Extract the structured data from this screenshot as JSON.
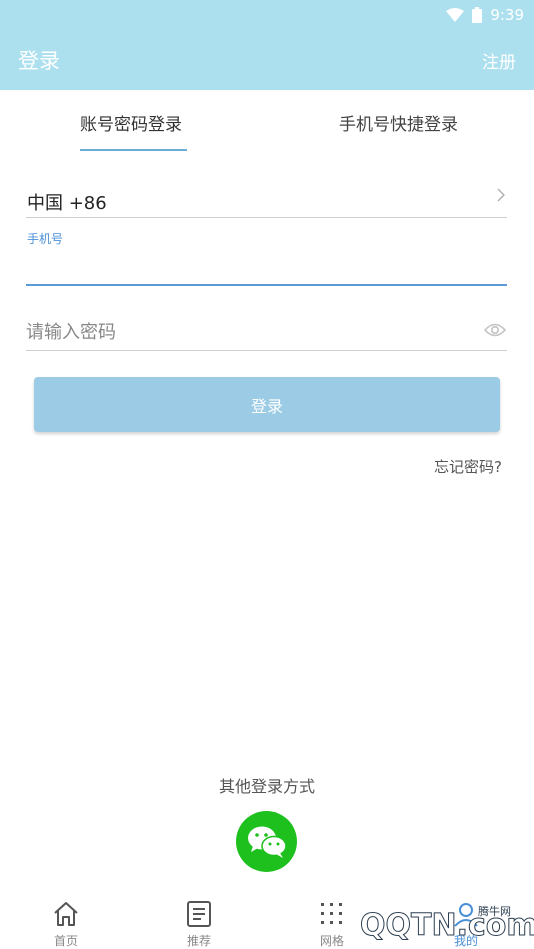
{
  "status_bar": {
    "time": "9:39"
  },
  "header": {
    "title": "登录",
    "register": "注册"
  },
  "tabs": [
    {
      "label": "账号密码登录",
      "active": true
    },
    {
      "label": "手机号快捷登录",
      "active": false
    }
  ],
  "form": {
    "country": "中国 +86",
    "phone_label": "手机号",
    "phone_value": "",
    "password_placeholder": "请输入密码",
    "login_button": "登录",
    "forgot": "忘记密码?"
  },
  "other_login": {
    "label": "其他登录方式",
    "wechat_icon": "wechat-icon"
  },
  "bottom_nav": [
    {
      "label": "首页",
      "icon": "home-icon"
    },
    {
      "label": "推荐",
      "icon": "document-icon"
    },
    {
      "label": "网格",
      "icon": "grid-icon"
    },
    {
      "label": "我的",
      "icon": "user-icon",
      "active": true
    }
  ],
  "watermark": {
    "text": "QQTN.com",
    "sub": "腾牛网"
  },
  "colors": {
    "header": "#ade0ee",
    "accent": "#4a90d9",
    "button": "#9ccbe5",
    "wechat": "#1ec01e"
  }
}
